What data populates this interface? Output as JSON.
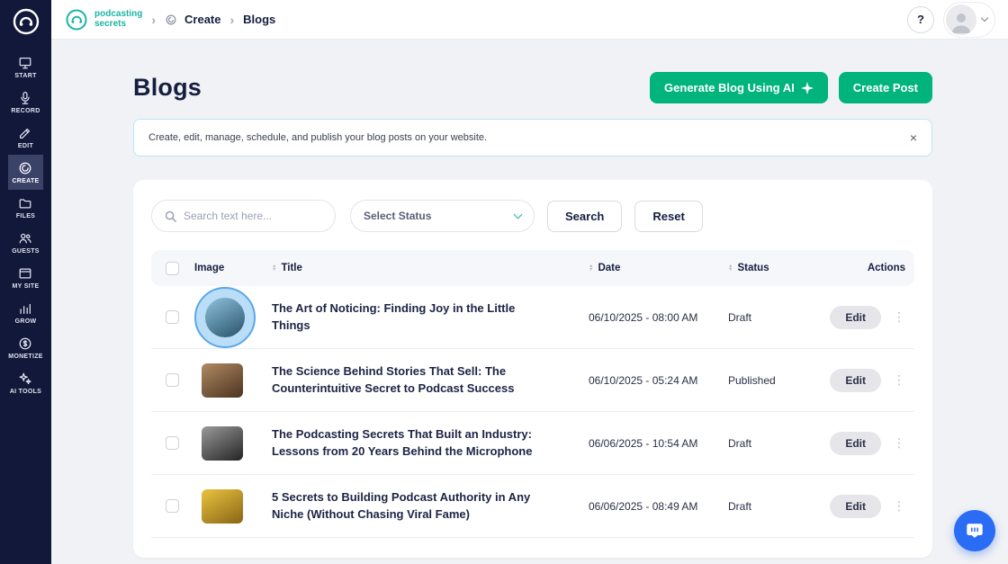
{
  "header": {
    "brand_line1": "podcasting",
    "brand_line2": "secrets",
    "breadcrumb": {
      "level1": "Create",
      "level2": "Blogs"
    },
    "help_label": "?"
  },
  "sidebar": {
    "items": [
      {
        "label": "START",
        "icon": "monitor-icon",
        "active": false
      },
      {
        "label": "RECORD",
        "icon": "mic-icon",
        "active": false
      },
      {
        "label": "EDIT",
        "icon": "edit-icon",
        "active": false
      },
      {
        "label": "CREATE",
        "icon": "create-icon",
        "active": true
      },
      {
        "label": "FILES",
        "icon": "files-icon",
        "active": false
      },
      {
        "label": "GUESTS",
        "icon": "guests-icon",
        "active": false
      },
      {
        "label": "MY SITE",
        "icon": "site-icon",
        "active": false
      },
      {
        "label": "GROW",
        "icon": "grow-icon",
        "active": false
      },
      {
        "label": "MONETIZE",
        "icon": "monetize-icon",
        "active": false
      },
      {
        "label": "AI TOOLS",
        "icon": "ai-tools-icon",
        "active": false
      }
    ]
  },
  "page": {
    "title": "Blogs",
    "generate_button": "Generate Blog Using AI",
    "create_button": "Create Post",
    "banner_text": "Create, edit, manage, schedule, and publish your blog posts on your website.",
    "banner_close": "×",
    "filters": {
      "search_placeholder": "Search text here...",
      "status_value": "Select Status",
      "search_button": "Search",
      "reset_button": "Reset"
    },
    "table": {
      "headers": {
        "image": "Image",
        "title": "Title",
        "date": "Date",
        "status": "Status",
        "actions": "Actions"
      },
      "edit_label": "Edit",
      "rows": [
        {
          "title": "The Art of Noticing: Finding Joy in the Little Things",
          "date": "06/10/2025 - 08:00 AM",
          "status": "Draft",
          "thumb": "ocean-cliff",
          "thumb_colors": [
            "#8fc3dd",
            "#27506a"
          ],
          "highlighted": true
        },
        {
          "title": "The Science Behind Stories That Sell: The Counterintuitive Secret to Podcast Success",
          "date": "06/10/2025 - 05:24 AM",
          "status": "Published",
          "thumb": "library-portrait",
          "thumb_colors": [
            "#b08a63",
            "#4c3320"
          ],
          "highlighted": false
        },
        {
          "title": "The Podcasting Secrets That Built an Industry: Lessons from 20 Years Behind the Microphone",
          "date": "06/06/2025 - 10:54 AM",
          "status": "Draft",
          "thumb": "microphone-dark",
          "thumb_colors": [
            "#9a9a9a",
            "#242424"
          ],
          "highlighted": false
        },
        {
          "title": "5 Secrets to Building Podcast Authority in Any Niche (Without Chasing Viral Fame)",
          "date": "06/06/2025 - 08:49 AM",
          "status": "Draft",
          "thumb": "studio-yellow",
          "thumb_colors": [
            "#e9c43f",
            "#8a6416"
          ],
          "highlighted": false
        }
      ]
    }
  },
  "colors": {
    "brand_teal": "#1ab5a3",
    "button_green": "#00b47c",
    "sidebar_bg": "#111839",
    "sidebar_active": "#3b4268",
    "banner_border": "#b9e6f6",
    "highlight_ring": "#59a8e8",
    "chat_blue": "#2b6cf5",
    "page_bg": "#f1f2f5",
    "text_dark": "#151e40"
  }
}
